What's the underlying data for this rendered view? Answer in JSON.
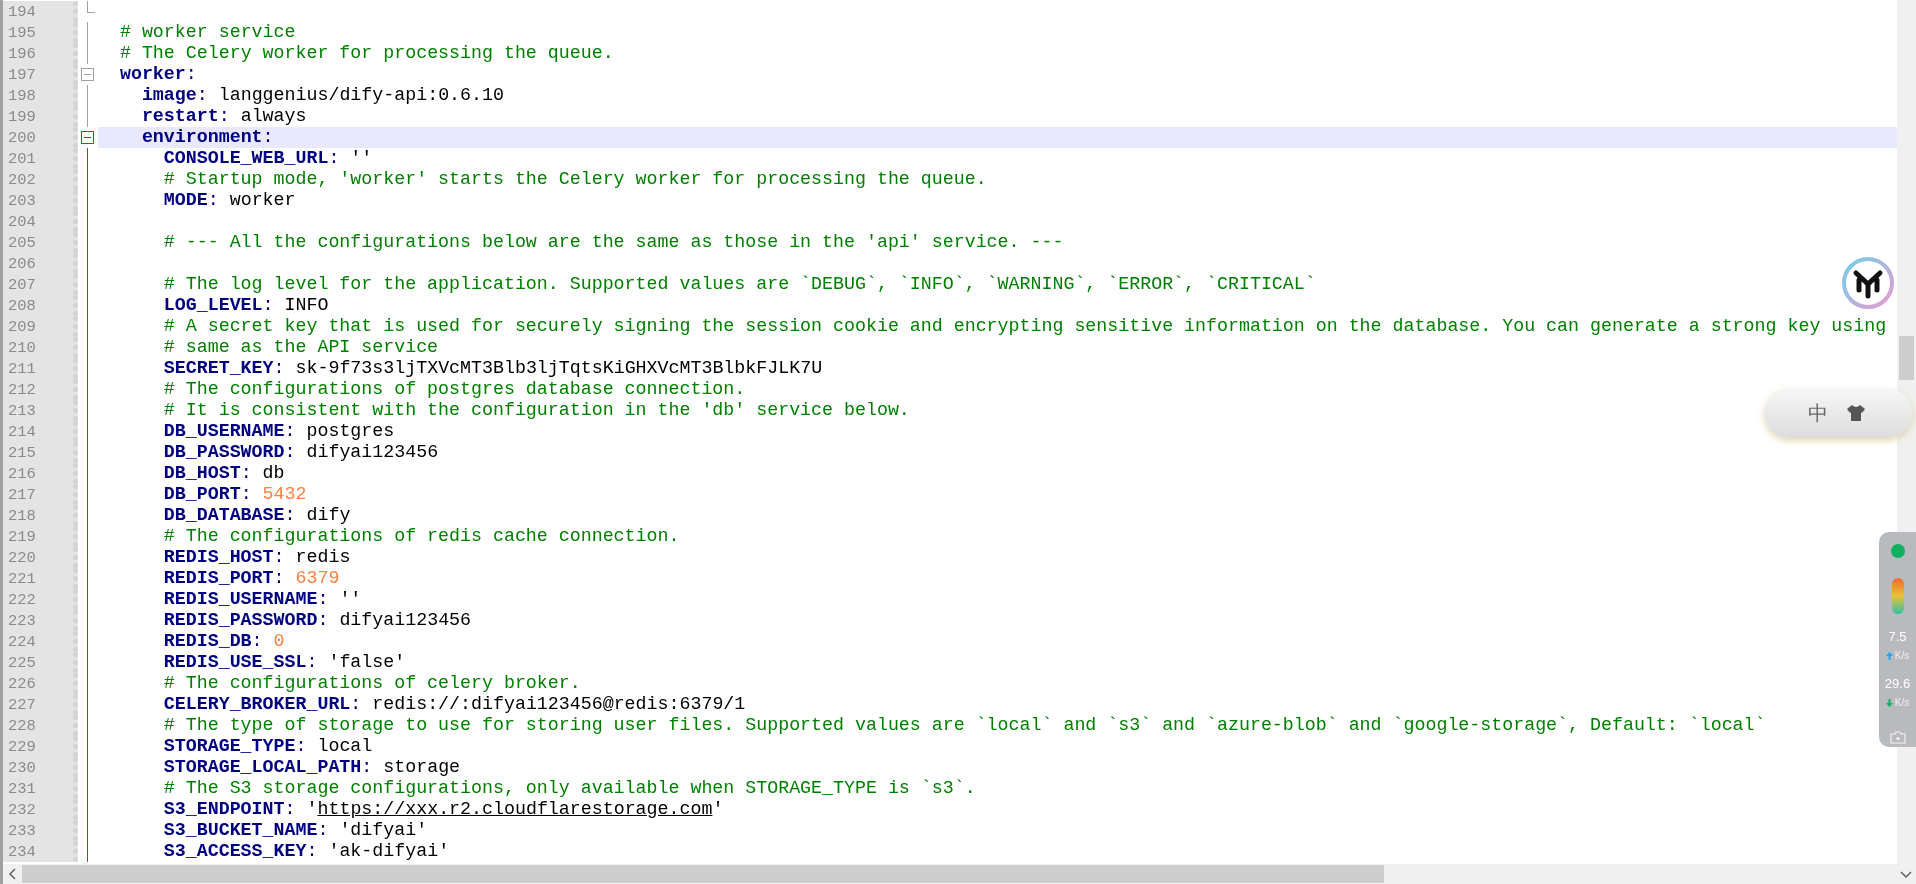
{
  "editor": {
    "lines": [
      {
        "number": "194",
        "kind": "fold-end",
        "active_block": false,
        "highlighted": false
      },
      {
        "number": "195",
        "kind": "plain",
        "active_block": false,
        "highlighted": false,
        "segments": [
          {
            "kind": "comment",
            "text": "  # worker service"
          }
        ]
      },
      {
        "number": "196",
        "kind": "plain",
        "active_block": false,
        "highlighted": false,
        "segments": [
          {
            "kind": "comment",
            "text": "  # The Celery worker for processing the queue."
          }
        ]
      },
      {
        "number": "197",
        "kind": "fold-start",
        "active_block": false,
        "highlighted": false,
        "segments": [
          {
            "kind": "key",
            "text": "  worker"
          },
          {
            "kind": "colon",
            "text": ":"
          }
        ]
      },
      {
        "number": "198",
        "kind": "plain",
        "active_block": false,
        "highlighted": false,
        "segments": [
          {
            "kind": "key",
            "text": "    image"
          },
          {
            "kind": "colon",
            "text": ":"
          },
          {
            "kind": "value",
            "text": " langgenius/dify-api:0.6.10"
          }
        ]
      },
      {
        "number": "199",
        "kind": "plain",
        "active_block": false,
        "highlighted": false,
        "segments": [
          {
            "kind": "key",
            "text": "    restart"
          },
          {
            "kind": "colon",
            "text": ":"
          },
          {
            "kind": "value",
            "text": " always"
          }
        ]
      },
      {
        "number": "200",
        "kind": "fold-start",
        "active_block": true,
        "highlighted": true,
        "segments": [
          {
            "kind": "key",
            "text": "    environment"
          },
          {
            "kind": "colon",
            "text": ":"
          }
        ]
      },
      {
        "number": "201",
        "kind": "plain",
        "active_block": true,
        "highlighted": false,
        "segments": [
          {
            "kind": "key",
            "text": "      CONSOLE_WEB_URL"
          },
          {
            "kind": "colon",
            "text": ":"
          },
          {
            "kind": "value",
            "text": " ''"
          }
        ]
      },
      {
        "number": "202",
        "kind": "plain",
        "active_block": true,
        "highlighted": false,
        "segments": [
          {
            "kind": "comment",
            "text": "      # Startup mode, 'worker' starts the Celery worker for processing the queue."
          }
        ]
      },
      {
        "number": "203",
        "kind": "plain",
        "active_block": true,
        "highlighted": false,
        "segments": [
          {
            "kind": "key",
            "text": "      MODE"
          },
          {
            "kind": "colon",
            "text": ":"
          },
          {
            "kind": "value",
            "text": " worker"
          }
        ]
      },
      {
        "number": "204",
        "kind": "plain",
        "active_block": true,
        "highlighted": false
      },
      {
        "number": "205",
        "kind": "plain",
        "active_block": true,
        "highlighted": false,
        "segments": [
          {
            "kind": "comment",
            "text": "      # --- All the configurations below are the same as those in the 'api' service. ---"
          }
        ]
      },
      {
        "number": "206",
        "kind": "plain",
        "active_block": true,
        "highlighted": false
      },
      {
        "number": "207",
        "kind": "plain",
        "active_block": true,
        "highlighted": false,
        "segments": [
          {
            "kind": "comment",
            "text": "      # The log level for the application. Supported values are `DEBUG`, `INFO`, `WARNING`, `ERROR`, `CRITICAL`"
          }
        ]
      },
      {
        "number": "208",
        "kind": "plain",
        "active_block": true,
        "highlighted": false,
        "segments": [
          {
            "kind": "key",
            "text": "      LOG_LEVEL"
          },
          {
            "kind": "colon",
            "text": ":"
          },
          {
            "kind": "value",
            "text": " INFO"
          }
        ]
      },
      {
        "number": "209",
        "kind": "plain",
        "active_block": true,
        "highlighted": false,
        "segments": [
          {
            "kind": "comment",
            "text": "      # A secret key that is used for securely signing the session cookie and encrypting sensitive information on the database. You can generate a strong key using"
          }
        ]
      },
      {
        "number": "210",
        "kind": "plain",
        "active_block": true,
        "highlighted": false,
        "segments": [
          {
            "kind": "comment",
            "text": "      # same as the API service"
          }
        ]
      },
      {
        "number": "211",
        "kind": "plain",
        "active_block": true,
        "highlighted": false,
        "segments": [
          {
            "kind": "key",
            "text": "      SECRET_KEY"
          },
          {
            "kind": "colon",
            "text": ":"
          },
          {
            "kind": "value",
            "text": " sk-9f73s3ljTXVcMT3Blb3ljTqtsKiGHXVcMT3BlbkFJLK7U"
          }
        ]
      },
      {
        "number": "212",
        "kind": "plain",
        "active_block": true,
        "highlighted": false,
        "segments": [
          {
            "kind": "comment",
            "text": "      # The configurations of postgres database connection."
          }
        ]
      },
      {
        "number": "213",
        "kind": "plain",
        "active_block": true,
        "highlighted": false,
        "segments": [
          {
            "kind": "comment",
            "text": "      # It is consistent with the configuration in the 'db' service below."
          }
        ]
      },
      {
        "number": "214",
        "kind": "plain",
        "active_block": true,
        "highlighted": false,
        "segments": [
          {
            "kind": "key",
            "text": "      DB_USERNAME"
          },
          {
            "kind": "colon",
            "text": ":"
          },
          {
            "kind": "value",
            "text": " postgres"
          }
        ]
      },
      {
        "number": "215",
        "kind": "plain",
        "active_block": true,
        "highlighted": false,
        "segments": [
          {
            "kind": "key",
            "text": "      DB_PASSWORD"
          },
          {
            "kind": "colon",
            "text": ":"
          },
          {
            "kind": "value",
            "text": " difyai123456"
          }
        ]
      },
      {
        "number": "216",
        "kind": "plain",
        "active_block": true,
        "highlighted": false,
        "segments": [
          {
            "kind": "key",
            "text": "      DB_HOST"
          },
          {
            "kind": "colon",
            "text": ":"
          },
          {
            "kind": "value",
            "text": " db"
          }
        ]
      },
      {
        "number": "217",
        "kind": "plain",
        "active_block": true,
        "highlighted": false,
        "segments": [
          {
            "kind": "key",
            "text": "      DB_PORT"
          },
          {
            "kind": "colon",
            "text": ":"
          },
          {
            "kind": "number",
            "text": " 5432"
          }
        ]
      },
      {
        "number": "218",
        "kind": "plain",
        "active_block": true,
        "highlighted": false,
        "segments": [
          {
            "kind": "key",
            "text": "      DB_DATABASE"
          },
          {
            "kind": "colon",
            "text": ":"
          },
          {
            "kind": "value",
            "text": " dify"
          }
        ]
      },
      {
        "number": "219",
        "kind": "plain",
        "active_block": true,
        "highlighted": false,
        "segments": [
          {
            "kind": "comment",
            "text": "      # The configurations of redis cache connection."
          }
        ]
      },
      {
        "number": "220",
        "kind": "plain",
        "active_block": true,
        "highlighted": false,
        "segments": [
          {
            "kind": "key",
            "text": "      REDIS_HOST"
          },
          {
            "kind": "colon",
            "text": ":"
          },
          {
            "kind": "value",
            "text": " redis"
          }
        ]
      },
      {
        "number": "221",
        "kind": "plain",
        "active_block": true,
        "highlighted": false,
        "segments": [
          {
            "kind": "key",
            "text": "      REDIS_PORT"
          },
          {
            "kind": "colon",
            "text": ":"
          },
          {
            "kind": "number",
            "text": " 6379"
          }
        ]
      },
      {
        "number": "222",
        "kind": "plain",
        "active_block": true,
        "highlighted": false,
        "segments": [
          {
            "kind": "key",
            "text": "      REDIS_USERNAME"
          },
          {
            "kind": "colon",
            "text": ":"
          },
          {
            "kind": "value",
            "text": " ''"
          }
        ]
      },
      {
        "number": "223",
        "kind": "plain",
        "active_block": true,
        "highlighted": false,
        "segments": [
          {
            "kind": "key",
            "text": "      REDIS_PASSWORD"
          },
          {
            "kind": "colon",
            "text": ":"
          },
          {
            "kind": "value",
            "text": " difyai123456"
          }
        ]
      },
      {
        "number": "224",
        "kind": "plain",
        "active_block": true,
        "highlighted": false,
        "segments": [
          {
            "kind": "key",
            "text": "      REDIS_DB"
          },
          {
            "kind": "colon",
            "text": ":"
          },
          {
            "kind": "number",
            "text": " 0"
          }
        ]
      },
      {
        "number": "225",
        "kind": "plain",
        "active_block": true,
        "highlighted": false,
        "segments": [
          {
            "kind": "key",
            "text": "      REDIS_USE_SSL"
          },
          {
            "kind": "colon",
            "text": ":"
          },
          {
            "kind": "value",
            "text": " 'false'"
          }
        ]
      },
      {
        "number": "226",
        "kind": "plain",
        "active_block": true,
        "highlighted": false,
        "segments": [
          {
            "kind": "comment",
            "text": "      # The configurations of celery broker."
          }
        ]
      },
      {
        "number": "227",
        "kind": "plain",
        "active_block": true,
        "highlighted": false,
        "segments": [
          {
            "kind": "key",
            "text": "      CELERY_BROKER_URL"
          },
          {
            "kind": "colon",
            "text": ":"
          },
          {
            "kind": "value",
            "text": " redis://:difyai123456@redis:6379/1"
          }
        ]
      },
      {
        "number": "228",
        "kind": "plain",
        "active_block": true,
        "highlighted": false,
        "segments": [
          {
            "kind": "comment",
            "text": "      # The type of storage to use for storing user files. Supported values are `local` and `s3` and `azure-blob` and `google-storage`, Default: `local`"
          }
        ]
      },
      {
        "number": "229",
        "kind": "plain",
        "active_block": true,
        "highlighted": false,
        "segments": [
          {
            "kind": "key",
            "text": "      STORAGE_TYPE"
          },
          {
            "kind": "colon",
            "text": ":"
          },
          {
            "kind": "value",
            "text": " local"
          }
        ]
      },
      {
        "number": "230",
        "kind": "plain",
        "active_block": true,
        "highlighted": false,
        "segments": [
          {
            "kind": "key",
            "text": "      STORAGE_LOCAL_PATH"
          },
          {
            "kind": "colon",
            "text": ":"
          },
          {
            "kind": "value",
            "text": " storage"
          }
        ]
      },
      {
        "number": "231",
        "kind": "plain",
        "active_block": true,
        "highlighted": false,
        "segments": [
          {
            "kind": "comment",
            "text": "      # The S3 storage configurations, only available when STORAGE_TYPE is `s3`."
          }
        ]
      },
      {
        "number": "232",
        "kind": "plain",
        "active_block": true,
        "highlighted": false,
        "segments": [
          {
            "kind": "key",
            "text": "      S3_ENDPOINT"
          },
          {
            "kind": "colon",
            "text": ":"
          },
          {
            "kind": "value",
            "text": " '"
          },
          {
            "kind": "url",
            "text": "https://xxx.r2.cloudflarestorage.com"
          },
          {
            "kind": "value",
            "text": "'"
          }
        ]
      },
      {
        "number": "233",
        "kind": "plain",
        "active_block": true,
        "highlighted": false,
        "segments": [
          {
            "kind": "key",
            "text": "      S3_BUCKET_NAME"
          },
          {
            "kind": "colon",
            "text": ":"
          },
          {
            "kind": "value",
            "text": " 'difyai'"
          }
        ]
      },
      {
        "number": "234",
        "kind": "plain",
        "active_block": true,
        "highlighted": false,
        "segments": [
          {
            "kind": "key",
            "text": "      S3_ACCESS_KEY"
          },
          {
            "kind": "colon",
            "text": ":"
          },
          {
            "kind": "value",
            "text": " 'ak-difyai'"
          }
        ]
      }
    ]
  },
  "ime_bar": {
    "label": "中"
  },
  "speed_meter": {
    "upload": "7.5",
    "upload_unit": "K/s",
    "download": "29.6",
    "download_unit": "K/s"
  }
}
